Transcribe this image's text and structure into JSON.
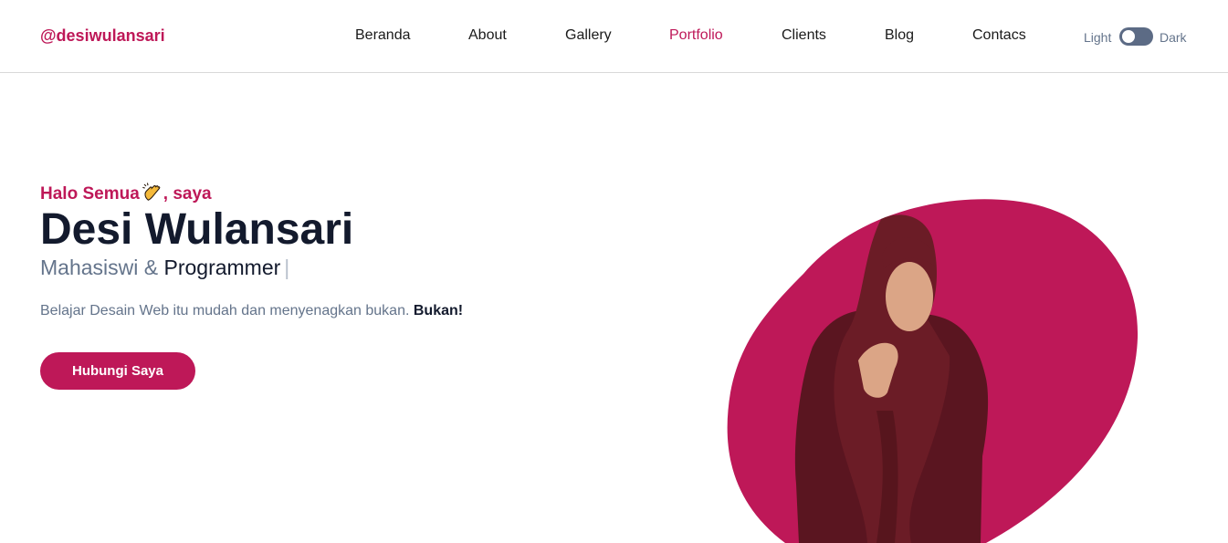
{
  "navbar": {
    "brand": "@desiwulansari",
    "links": [
      {
        "label": "Beranda",
        "active": false
      },
      {
        "label": "About",
        "active": false
      },
      {
        "label": "Gallery",
        "active": false
      },
      {
        "label": "Portfolio",
        "active": true
      },
      {
        "label": "Clients",
        "active": false
      },
      {
        "label": "Blog",
        "active": false
      },
      {
        "label": "Contacs",
        "active": false
      }
    ],
    "theme_toggle": {
      "light_label": "Light",
      "dark_label": "Dark",
      "state": "light"
    }
  },
  "hero": {
    "greeting_pre": "Halo Semua",
    "greeting_icon": "waving-hand-icon",
    "greeting_post": ", saya",
    "name": "Desi Wulansari",
    "role_static": "Mahasiswi & ",
    "role_typed": "Programmer",
    "role_cursor": "|",
    "description": "Belajar Desain Web itu mudah dan menyenagkan bukan. ",
    "description_strong": "Bukan!",
    "cta_label": "Hubungi Saya",
    "image": "portrait-photo"
  },
  "colors": {
    "accent": "#be1858",
    "heading": "#131a2d",
    "muted": "#64748b",
    "toggle": "#5c6b85",
    "border": "#d9d9d9",
    "blob": "#be1858",
    "garment": "#6b1c26"
  }
}
